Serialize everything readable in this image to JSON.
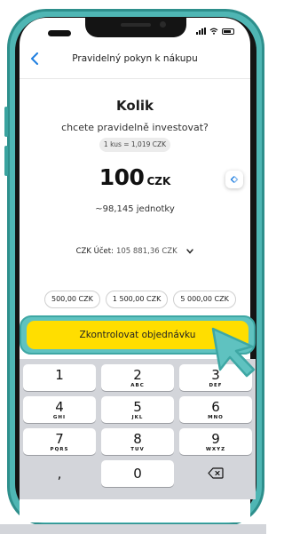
{
  "nav": {
    "title": "Pravidelný pokyn k nákupu"
  },
  "order": {
    "heading": "Kolik",
    "subheading": "chcete pravidelně investovat?",
    "unit_price": "1 kus = 1,019 CZK",
    "amount": "100",
    "currency": "CZK",
    "units": "~98,145 jednotky"
  },
  "account": {
    "label": "CZK Účet:",
    "value": "105 881,36 CZK"
  },
  "quick_amounts": [
    "500,00 CZK",
    "1 500,00 CZK",
    "5 000,00 CZK"
  ],
  "cta": {
    "label": "Zkontrolovat objednávku"
  },
  "keypad": {
    "keys": [
      {
        "digit": "1",
        "letters": ""
      },
      {
        "digit": "2",
        "letters": "ABC"
      },
      {
        "digit": "3",
        "letters": "DEF"
      },
      {
        "digit": "4",
        "letters": "GHI"
      },
      {
        "digit": "5",
        "letters": "JKL"
      },
      {
        "digit": "6",
        "letters": "MNO"
      },
      {
        "digit": "7",
        "letters": "PQRS"
      },
      {
        "digit": "8",
        "letters": "TUV"
      },
      {
        "digit": "9",
        "letters": "WXYZ"
      }
    ],
    "comma": ",",
    "zero": "0"
  },
  "icons": {
    "back": "chevron-left-icon",
    "swap": "swap-arrows-icon",
    "dropdown": "chevron-down-icon",
    "delete": "backspace-icon",
    "pointer": "hand-cursor-icon"
  },
  "colors": {
    "accent_blue": "#1f7fe0",
    "cta_yellow": "#ffde00",
    "frame_teal": "#4fb6b4"
  }
}
